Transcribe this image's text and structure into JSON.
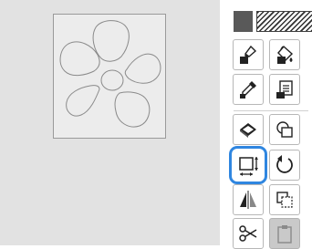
{
  "canvas": {
    "background": "#e2e2e2",
    "artboard_motif": "flower-outline"
  },
  "toolbar": {
    "colors": {
      "solid": "#595959",
      "pattern": "diagonal-hatch",
      "selection_highlight": "#2f86e0"
    },
    "tools": [
      {
        "id": "line-brush",
        "icon": "paint-brush-icon",
        "selected": false,
        "enabled": true
      },
      {
        "id": "fill",
        "icon": "paint-bucket-icon",
        "selected": false,
        "enabled": true
      },
      {
        "id": "eyedropper",
        "icon": "eyedropper-icon",
        "selected": false,
        "enabled": true
      },
      {
        "id": "stamp",
        "icon": "stamp-icon",
        "selected": false,
        "enabled": true
      },
      {
        "id": "eraser",
        "icon": "eraser-icon",
        "selected": false,
        "enabled": true
      },
      {
        "id": "select-shape",
        "icon": "shape-select-icon",
        "selected": false,
        "enabled": true
      },
      {
        "id": "resize",
        "icon": "resize-icon",
        "selected": true,
        "enabled": true
      },
      {
        "id": "rotate",
        "icon": "rotate-icon",
        "selected": false,
        "enabled": true
      },
      {
        "id": "flip",
        "icon": "flip-horizontal-icon",
        "selected": false,
        "enabled": true
      },
      {
        "id": "duplicate",
        "icon": "duplicate-icon",
        "selected": false,
        "enabled": true
      },
      {
        "id": "cut",
        "icon": "scissors-icon",
        "selected": false,
        "enabled": true
      },
      {
        "id": "paste",
        "icon": "clipboard-icon",
        "selected": false,
        "enabled": false
      }
    ]
  }
}
